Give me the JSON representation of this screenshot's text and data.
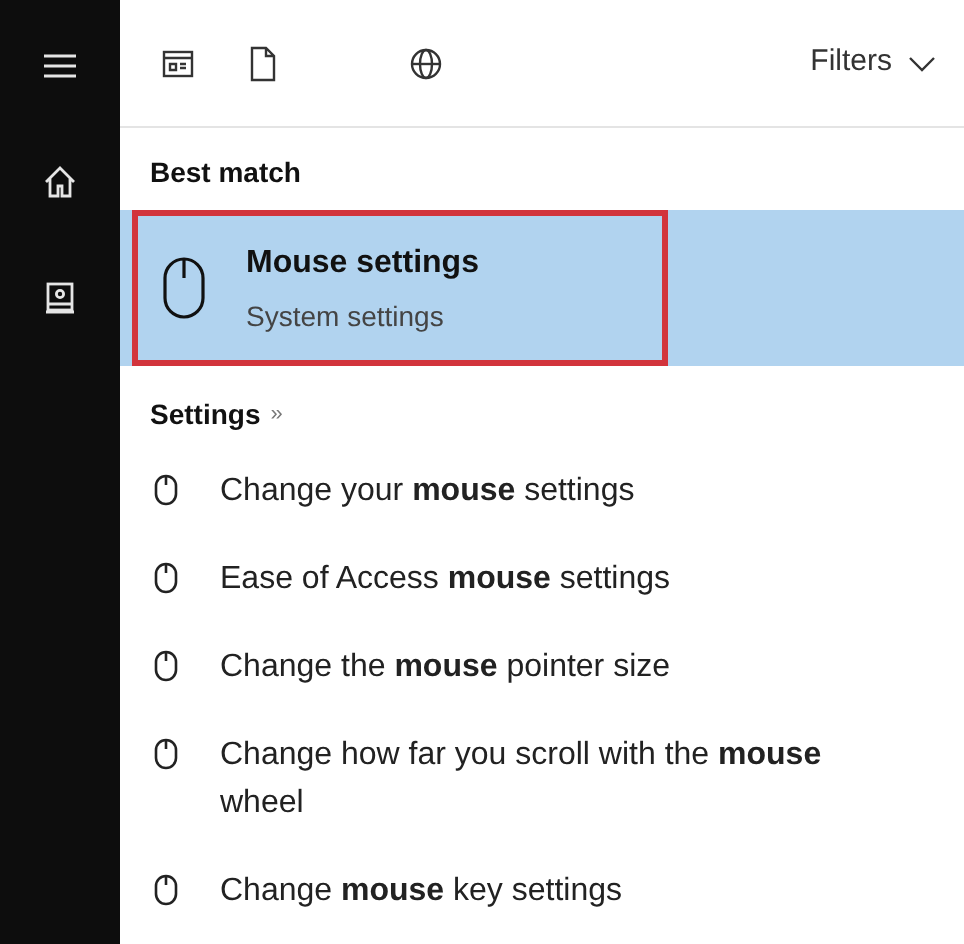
{
  "sidebar": {
    "items": [
      {
        "kind": "menu"
      },
      {
        "kind": "home"
      },
      {
        "kind": "photo"
      }
    ]
  },
  "toolbar": {
    "filters": [
      {
        "kind": "apps"
      },
      {
        "kind": "documents"
      },
      {
        "kind": "web"
      }
    ],
    "filters_button": "Filters"
  },
  "best_match": {
    "heading": "Best match",
    "item": {
      "title": "Mouse settings",
      "subtitle": "System settings",
      "selected": true,
      "outlined": true
    }
  },
  "settings": {
    "heading": "Settings",
    "more": "»",
    "items": [
      {
        "text": "Change your **mouse** settings"
      },
      {
        "text": "Ease of Access **mouse** settings"
      },
      {
        "text": "Change the **mouse** pointer size"
      },
      {
        "text": "Change how far you scroll with the **mouse** wheel"
      },
      {
        "text": "Change **mouse** key settings"
      }
    ]
  }
}
